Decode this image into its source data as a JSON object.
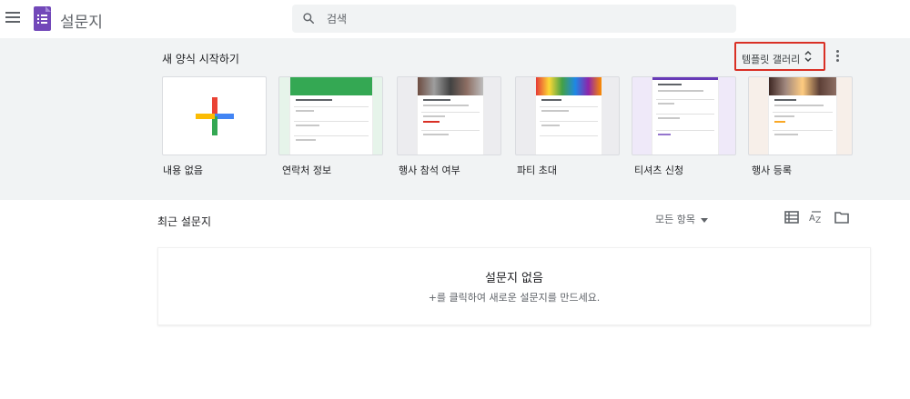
{
  "app": {
    "title": "설문지",
    "logo_icon": "forms-logo-icon",
    "brand_color": "#7248b9"
  },
  "search": {
    "placeholder": "검색"
  },
  "templates": {
    "section_title": "새 양식 시작하기",
    "gallery_label": "템플릿 갤러리",
    "highlight_color": "#d93025",
    "items": [
      {
        "label": "내용 없음"
      },
      {
        "label": "연락처 정보"
      },
      {
        "label": "행사 참석 여부"
      },
      {
        "label": "파티 초대"
      },
      {
        "label": "티셔츠 신청"
      },
      {
        "label": "행사 등록"
      }
    ]
  },
  "recent": {
    "title": "최근 설문지",
    "filter_label": "모든 항목",
    "empty_title": "설문지 없음",
    "empty_desc": "+를 클릭하여 새로운 설문지를 만드세요."
  }
}
